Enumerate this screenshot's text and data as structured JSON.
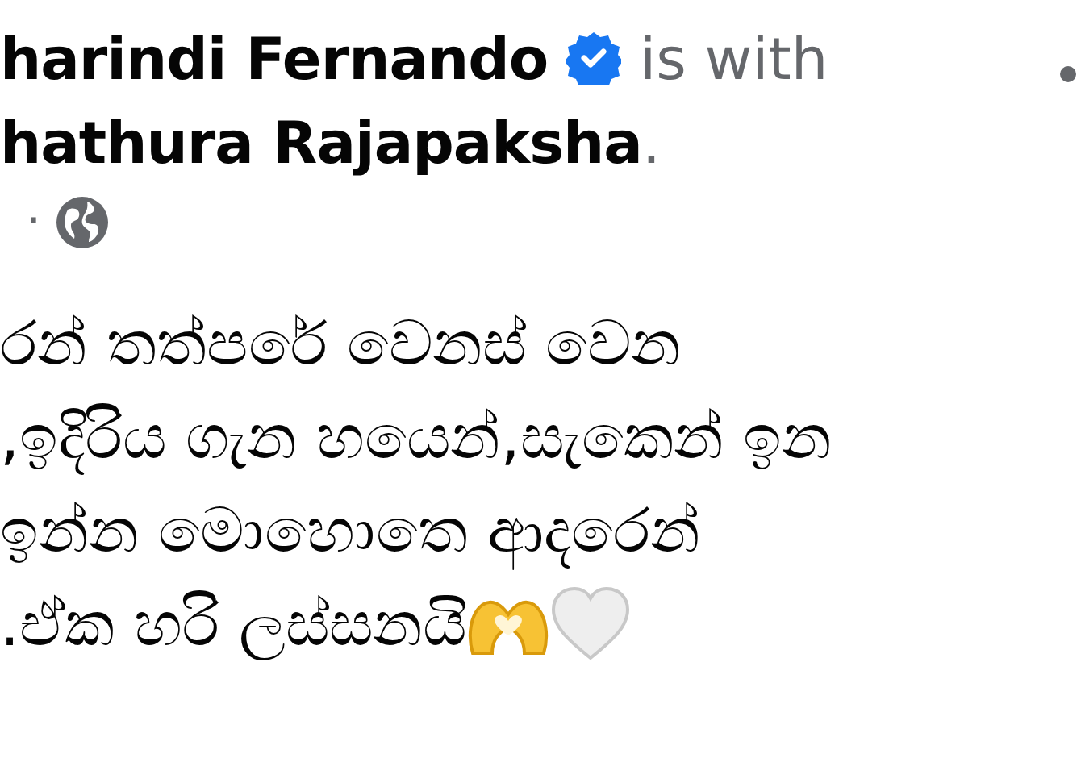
{
  "post": {
    "author": "harindi Fernando",
    "verified": true,
    "with_text": "is with",
    "tagged": "hathura Rajapaksha",
    "tagged_end": ".",
    "meta_separator": "·",
    "body_lines": [
      "රන් තත්පරේ වෙනස් වෙන",
      ",ඉදිරිය ගැන හයෙන්,සැකෙන් ඉන",
      "ඉන්න මොහොතෙ ආදරෙන්",
      ".ඒක හරි ලස්සනයි"
    ]
  }
}
